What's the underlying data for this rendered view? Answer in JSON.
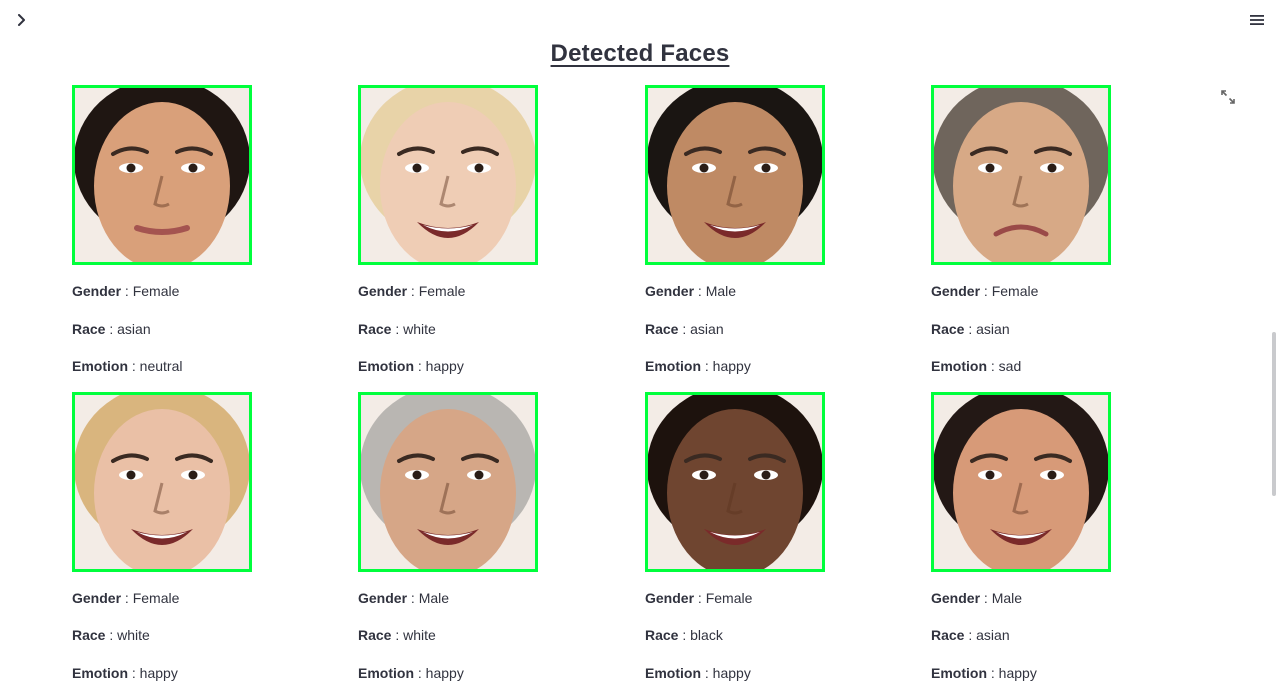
{
  "header": {
    "title": "Detected Faces"
  },
  "labels": {
    "gender": "Gender",
    "race": "Race",
    "emotion": "Emotion",
    "separator": ":"
  },
  "colors": {
    "frame": "#00ff3c",
    "text": "#31333f"
  },
  "icons": {
    "sidebar": "chevron-right-icon",
    "menu": "hamburger-menu-icon",
    "fullscreen": "expand-icon"
  },
  "faces": [
    {
      "gender": "Female",
      "race": "asian",
      "emotion": "neutral",
      "skin": "#d9a07a",
      "hair": "#1f1612",
      "mood": "neutral"
    },
    {
      "gender": "Female",
      "race": "white",
      "emotion": "happy",
      "skin": "#efcdb5",
      "hair": "#e8d3a8",
      "mood": "happy"
    },
    {
      "gender": "Male",
      "race": "asian",
      "emotion": "happy",
      "skin": "#bf8a64",
      "hair": "#1a1512",
      "mood": "happy"
    },
    {
      "gender": "Female",
      "race": "asian",
      "emotion": "sad",
      "skin": "#d7a986",
      "hair": "#6f655c",
      "mood": "sad"
    },
    {
      "gender": "Female",
      "race": "white",
      "emotion": "happy",
      "skin": "#eac0a6",
      "hair": "#d9b57e",
      "mood": "happy"
    },
    {
      "gender": "Male",
      "race": "white",
      "emotion": "happy",
      "skin": "#d6a687",
      "hair": "#b9b6b2",
      "mood": "happy"
    },
    {
      "gender": "Female",
      "race": "black",
      "emotion": "happy",
      "skin": "#6f4530",
      "hair": "#1d120d",
      "mood": "happy"
    },
    {
      "gender": "Male",
      "race": "asian",
      "emotion": "happy",
      "skin": "#d79a78",
      "hair": "#231815",
      "mood": "happy"
    }
  ]
}
